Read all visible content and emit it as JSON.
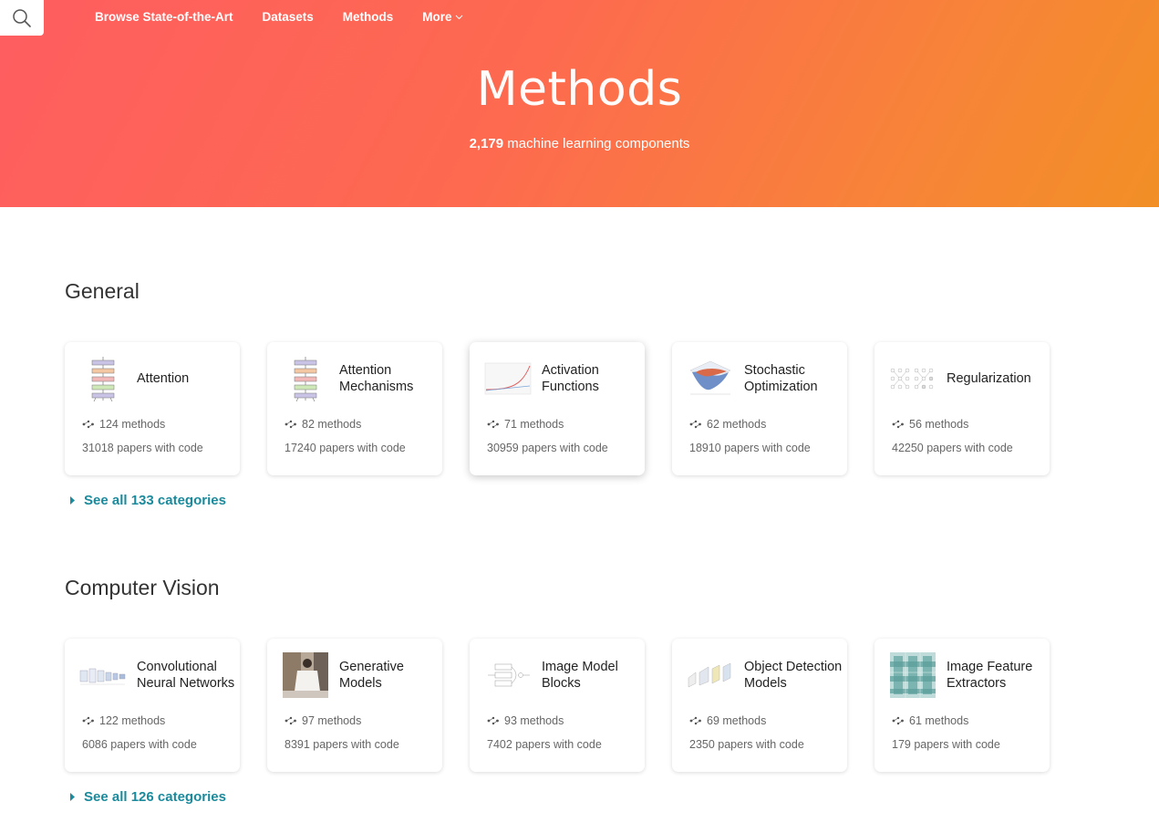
{
  "nav": {
    "items": [
      {
        "label": "Browse State-of-the-Art"
      },
      {
        "label": "Datasets"
      },
      {
        "label": "Methods"
      },
      {
        "label": "More"
      }
    ]
  },
  "hero": {
    "title": "Methods",
    "count": "2,179",
    "subtitle_rest": " machine learning components"
  },
  "sections": [
    {
      "title": "General",
      "see_all": "See all 133 categories",
      "cards": [
        {
          "name": "Attention",
          "methods": "124 methods",
          "papers": "31018 papers with code",
          "icon": "transformer-diagram-icon"
        },
        {
          "name": "Attention Mechanisms",
          "methods": "82 methods",
          "papers": "17240 papers with code",
          "icon": "transformer-diagram-icon"
        },
        {
          "name": "Activation Functions",
          "methods": "71 methods",
          "papers": "30959 papers with code",
          "icon": "activation-curve-icon"
        },
        {
          "name": "Stochastic Optimization",
          "methods": "62 methods",
          "papers": "18910 papers with code",
          "icon": "loss-surface-icon"
        },
        {
          "name": "Regularization",
          "methods": "56 methods",
          "papers": "42250 papers with code",
          "icon": "dropout-network-icon"
        }
      ]
    },
    {
      "title": "Computer Vision",
      "see_all": "See all 126 categories",
      "cards": [
        {
          "name": "Convolutional Neural Networks",
          "methods": "122 methods",
          "papers": "6086 papers with code",
          "icon": "cnn-layers-icon"
        },
        {
          "name": "Generative Models",
          "methods": "97 methods",
          "papers": "8391 papers with code",
          "icon": "generated-photo-icon"
        },
        {
          "name": "Image Model Blocks",
          "methods": "93 methods",
          "papers": "7402 papers with code",
          "icon": "block-diagram-icon"
        },
        {
          "name": "Object Detection Models",
          "methods": "69 methods",
          "papers": "2350 papers with code",
          "icon": "detection-pipeline-icon"
        },
        {
          "name": "Image Feature Extractors",
          "methods": "61 methods",
          "papers": "179 papers with code",
          "icon": "feature-grid-icon"
        }
      ]
    }
  ],
  "colors": {
    "hero_start": "#fe5d60",
    "hero_end": "#f28f25",
    "link": "#1a8a9c"
  }
}
